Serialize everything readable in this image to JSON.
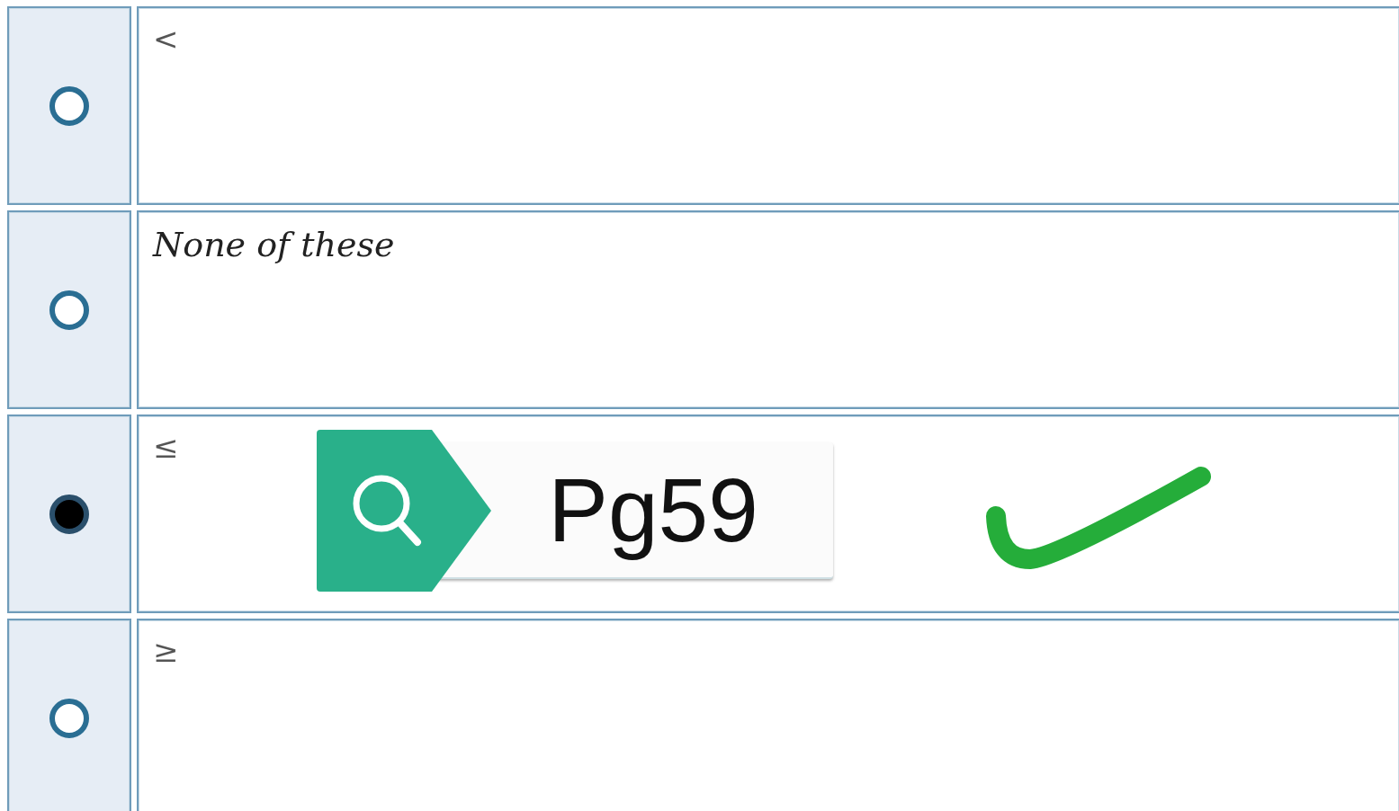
{
  "options": [
    {
      "label": "<",
      "kind": "symbol",
      "selected": false
    },
    {
      "label": "None of these",
      "kind": "text",
      "selected": false
    },
    {
      "label": "≤",
      "kind": "symbol",
      "selected": true
    },
    {
      "label": "≥",
      "kind": "symbol",
      "selected": false
    }
  ],
  "page_tag": {
    "value": "Pg59"
  }
}
